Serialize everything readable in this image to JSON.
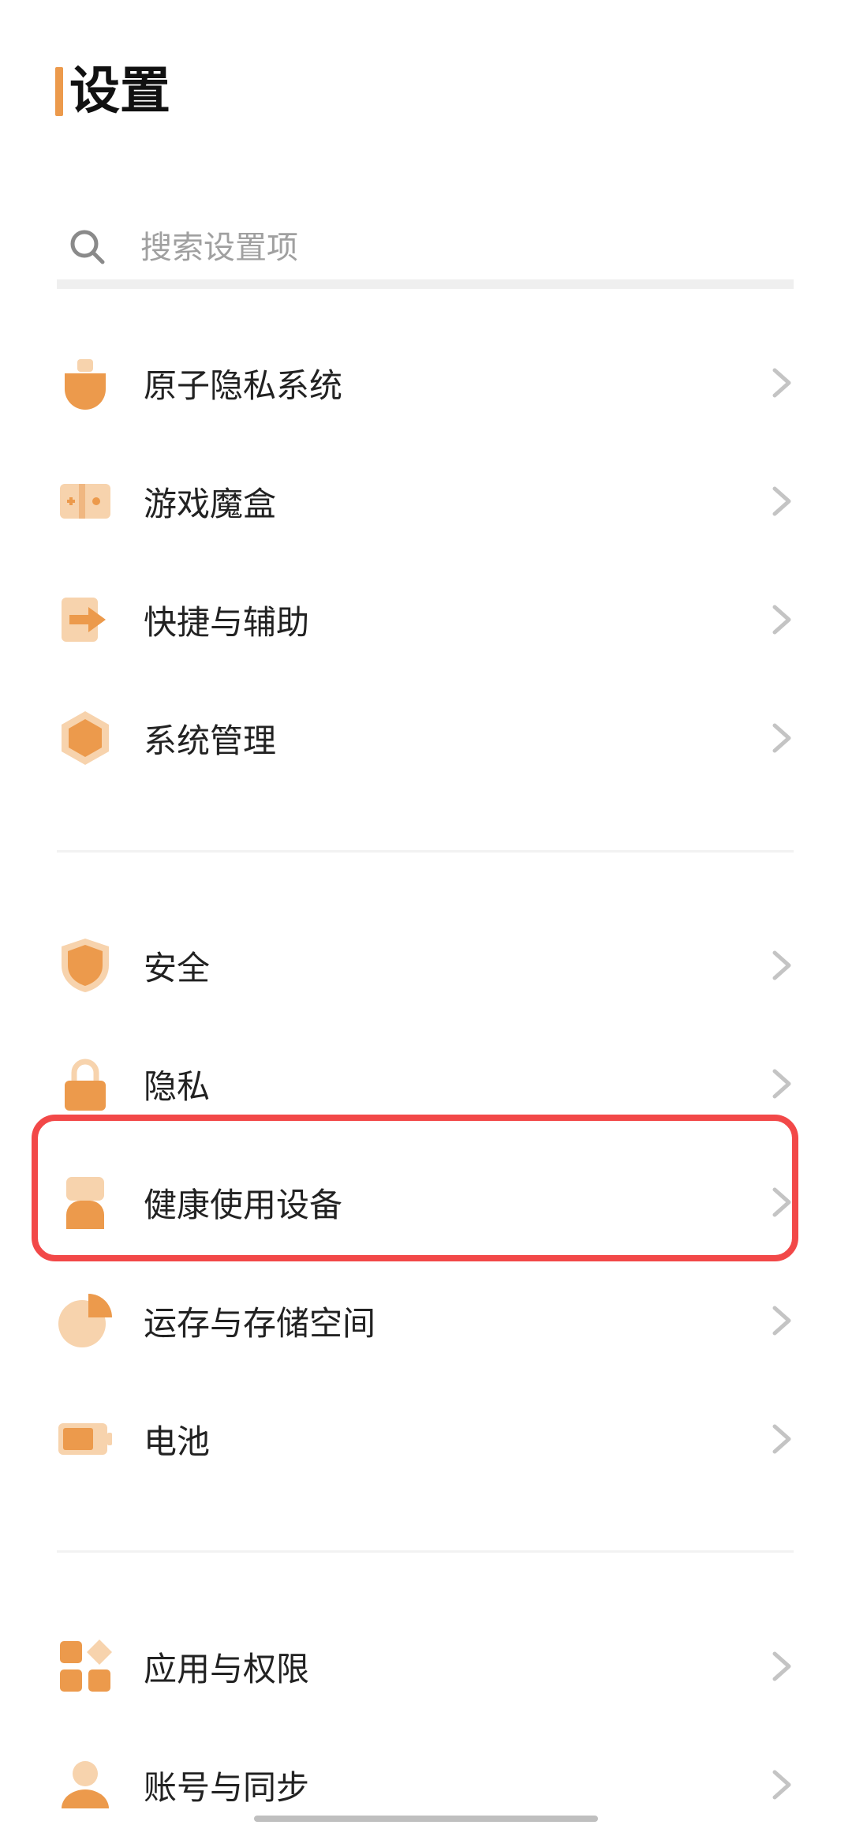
{
  "header": {
    "title": "设置"
  },
  "search": {
    "placeholder": "搜索设置项"
  },
  "groups": [
    {
      "items": [
        {
          "label": "原子隐私系统",
          "icon": "privacy-system-icon"
        },
        {
          "label": "游戏魔盒",
          "icon": "game-box-icon"
        },
        {
          "label": "快捷与辅助",
          "icon": "shortcut-assist-icon"
        },
        {
          "label": "系统管理",
          "icon": "system-management-icon"
        }
      ]
    },
    {
      "items": [
        {
          "label": "安全",
          "icon": "shield-icon"
        },
        {
          "label": "隐私",
          "icon": "lock-icon"
        },
        {
          "label": "健康使用设备",
          "icon": "hourglass-icon",
          "highlighted": true
        },
        {
          "label": "运存与存储空间",
          "icon": "storage-pie-icon"
        },
        {
          "label": "电池",
          "icon": "battery-icon"
        }
      ]
    },
    {
      "items": [
        {
          "label": "应用与权限",
          "icon": "apps-permissions-icon"
        },
        {
          "label": "账号与同步",
          "icon": "account-icon"
        }
      ]
    }
  ],
  "colors": {
    "accent": "#ec9a4c",
    "accent_light": "#f7d3ad",
    "highlight_border": "#f24848"
  }
}
